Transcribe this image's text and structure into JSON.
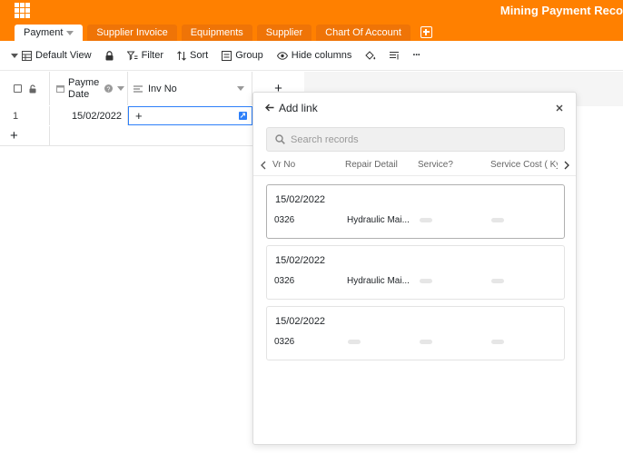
{
  "app": {
    "title": "Mining Payment Reco"
  },
  "tabs": [
    {
      "label": "Payment",
      "active": true
    },
    {
      "label": "Supplier Invoice"
    },
    {
      "label": "Equipments"
    },
    {
      "label": "Supplier"
    },
    {
      "label": "Chart Of Account"
    }
  ],
  "toolbar": {
    "view_label": "Default View",
    "filter_label": "Filter",
    "sort_label": "Sort",
    "group_label": "Group",
    "hide_columns_label": "Hide columns",
    "more_label": "···"
  },
  "grid": {
    "columns": [
      {
        "label_line1": "Payme",
        "label_line2": "Date"
      },
      {
        "label": "Inv No"
      }
    ],
    "rows": [
      {
        "row_number": "1",
        "payment_date": "15/02/2022",
        "inv_no_add": "+"
      }
    ],
    "add_row_label": "+",
    "add_column_label": "+"
  },
  "add_link": {
    "title": "Add link",
    "search_placeholder": "Search records",
    "columns": [
      "Vr No",
      "Repair Detail",
      "Service?",
      "Service Cost ( Kya"
    ],
    "records": [
      {
        "date": "15/02/2022",
        "vr_no": "0326",
        "repair_detail": "Hydraulic Mai...",
        "selected": true
      },
      {
        "date": "15/02/2022",
        "vr_no": "0326",
        "repair_detail": "Hydraulic Mai..."
      },
      {
        "date": "15/02/2022",
        "vr_no": "0326",
        "repair_detail": ""
      }
    ]
  },
  "colors": {
    "brand": "#ff8000",
    "tab_inactive": "#ef7407",
    "selection": "#2d7ff9"
  }
}
